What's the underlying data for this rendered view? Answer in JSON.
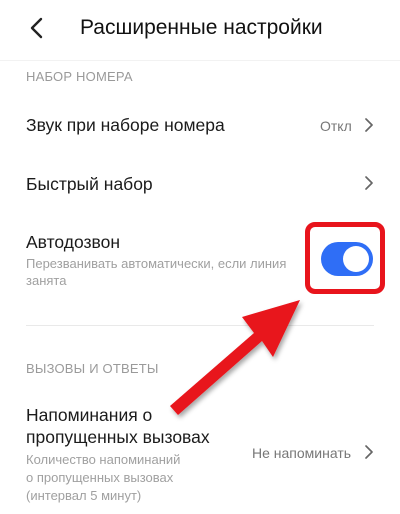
{
  "header": {
    "title": "Расширенные настройки",
    "back_icon": "arrow-left-icon"
  },
  "sections": {
    "dialing": {
      "heading": "НАБОР НОМЕРА",
      "dial_sound": {
        "label": "Звук при наборе номера",
        "value": "Откл"
      },
      "speed_dial": {
        "label": "Быстрый набор"
      },
      "auto_redial": {
        "label": "Автодозвон",
        "description_line1": "Перезванивать автоматически, если линия",
        "description_line2": "занята",
        "enabled": true
      }
    },
    "calls": {
      "heading": "ВЫЗОВЫ И ОТВЕТЫ",
      "missed_reminders": {
        "label_line1": "Напоминания о",
        "label_line2": "пропущенных вызовах",
        "description_line1": "Количество напоминаний",
        "description_line2": "о пропущенных вызовах",
        "description_line3": "(интервал 5 минут)",
        "value": "Не напоминать"
      }
    }
  },
  "annotation": {
    "highlight_color": "#e8141c",
    "arrow_color": "#e8141c"
  },
  "colors": {
    "accent": "#2f6ef6",
    "section_heading": "#9a9a9a"
  }
}
